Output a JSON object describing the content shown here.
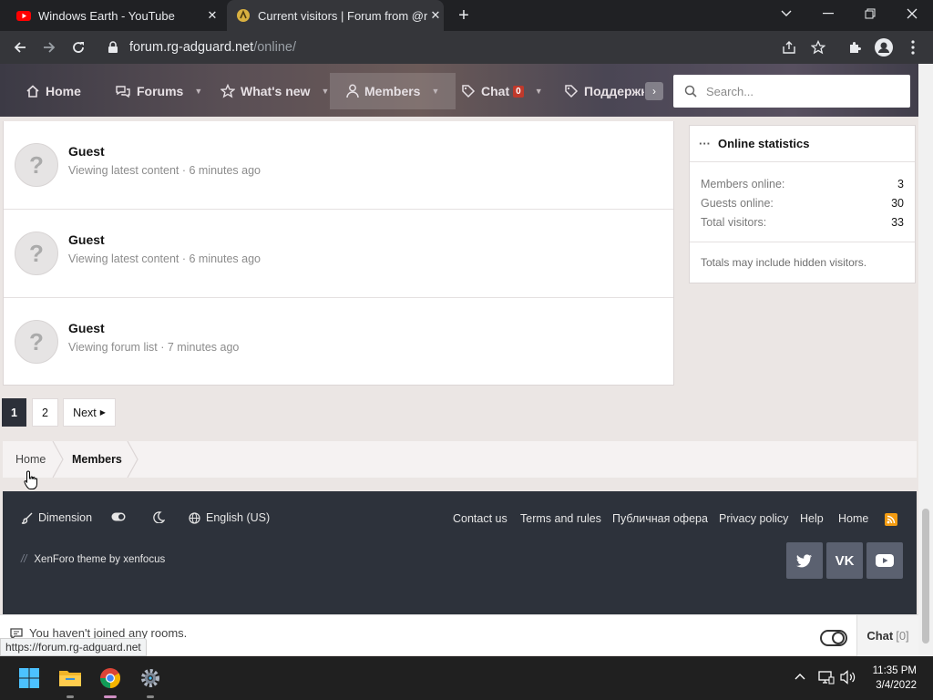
{
  "browser": {
    "tabs": [
      {
        "title": "Windows Earth - YouTube",
        "icon": "youtube-icon",
        "active": false
      },
      {
        "title": "Current visitors | Forum from @r...",
        "icon": "forum-favicon-icon",
        "active": true
      }
    ],
    "url_domain": "forum.rg-adguard.net",
    "url_path": "/online/",
    "status_url": "https://forum.rg-adguard.net"
  },
  "nav": {
    "items": [
      {
        "label": "Home",
        "icon": "home-icon"
      },
      {
        "label": "Forums",
        "icon": "chat-bubbles-icon"
      },
      {
        "label": "What's new",
        "icon": "star-icon"
      },
      {
        "label": "Members",
        "icon": "user-icon"
      },
      {
        "label": "Chat",
        "icon": "tag-icon",
        "badge": "0"
      },
      {
        "label": "Поддержк",
        "icon": "tag-icon"
      }
    ],
    "search_placeholder": "Search..."
  },
  "visitors": [
    {
      "name": "Guest",
      "activity": "Viewing latest content · 6 minutes ago"
    },
    {
      "name": "Guest",
      "activity": "Viewing latest content · 6 minutes ago"
    },
    {
      "name": "Guest",
      "activity": "Viewing forum list · 7 minutes ago"
    }
  ],
  "avatar_placeholder": "?",
  "sidebar": {
    "title": "Online statistics",
    "rows": [
      {
        "label": "Members online:",
        "value": "3"
      },
      {
        "label": "Guests online:",
        "value": "30"
      },
      {
        "label": "Total visitors:",
        "value": "33"
      }
    ],
    "note": "Totals may include hidden visitors."
  },
  "pagination": {
    "pages": [
      "1",
      "2"
    ],
    "current": "1",
    "next": "Next"
  },
  "breadcrumb": [
    "Home",
    "Members"
  ],
  "footer": {
    "dimension": "Dimension",
    "language": "English (US)",
    "links": [
      "Contact us",
      "Terms and rules",
      "Публичная офера",
      "Privacy policy",
      "Help",
      "Home"
    ],
    "theme_credit": "XenForo theme by xenfocus",
    "social": [
      "twitter-icon",
      "vk-icon",
      "youtube-icon"
    ]
  },
  "chat": {
    "message": "You haven't joined any rooms.",
    "button": "Chat",
    "count": "[0]"
  },
  "taskbar": {
    "time": "11:35 PM",
    "date": "3/4/2022"
  },
  "colors": {
    "footer_bg": "#2d323b",
    "badge_red": "#c0392b",
    "current_page": "#2c3039"
  }
}
